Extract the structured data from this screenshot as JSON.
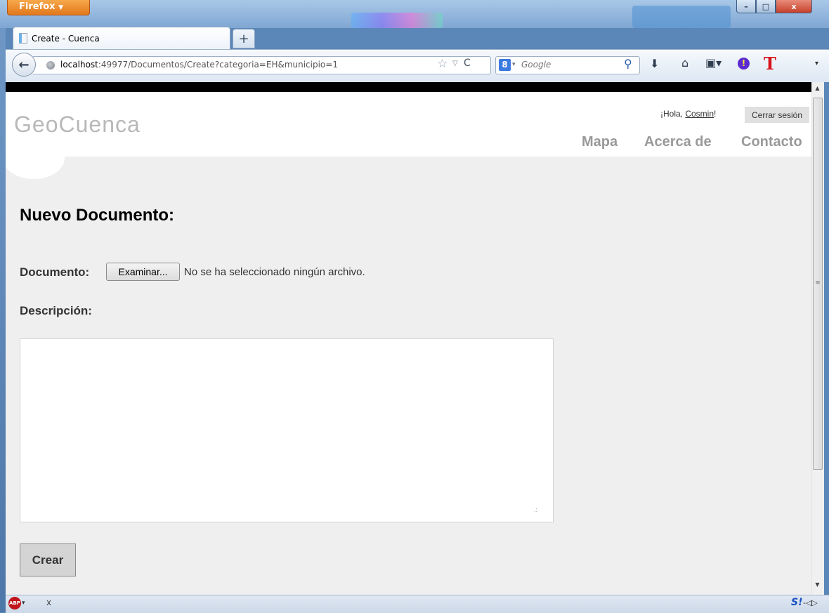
{
  "window": {
    "app_button": "Firefox",
    "app_button_arrow": "▼",
    "controls": {
      "minimize": "–",
      "maximize": "□",
      "close": "x"
    }
  },
  "tab": {
    "title": "Create - Cuenca",
    "new_tab": "+"
  },
  "navigation": {
    "back": "←",
    "url_host": "localhost",
    "url_rest": ":49977/Documentos/Create?categoria=EH&municipio=1",
    "star": "☆",
    "dropdown": "▽",
    "reload": "C",
    "search_engine_icon": "8",
    "search_engine_dropdown": "▾",
    "search_placeholder": "Google",
    "search_icon": "⚲",
    "toolbar": {
      "download": "⬇",
      "home": "⌂",
      "bookmarks": "▣▾",
      "addon": "!",
      "t_addon": "T",
      "menu": "▾"
    }
  },
  "site": {
    "title": "GeoCuenca",
    "greeting_prefix": "¡Hola, ",
    "username": "Cosmin",
    "greeting_suffix": "!",
    "logout": "Cerrar sesión",
    "nav": [
      "Mapa",
      "Acerca de",
      "Contacto"
    ]
  },
  "form": {
    "heading": "Nuevo Documento:",
    "document_label": "Documento:",
    "browse_button": "Examinar...",
    "no_file_text": "No se ha seleccionado ningún archivo.",
    "description_label": "Descripción:",
    "description_value": "",
    "submit": "Crear"
  },
  "scrollbar": {
    "up": "▲",
    "grip": "≡",
    "down": "▼"
  },
  "statusbar": {
    "abp": "ABP",
    "abp_dropdown": "▾",
    "close": "x",
    "s_icon": "S!",
    "plugin": "-◁▷"
  },
  "colors": {
    "accent_orange": "#e2781c",
    "page_bg": "#efefef",
    "header_bg": "#ffffff",
    "site_title": "#b8b8b8"
  }
}
